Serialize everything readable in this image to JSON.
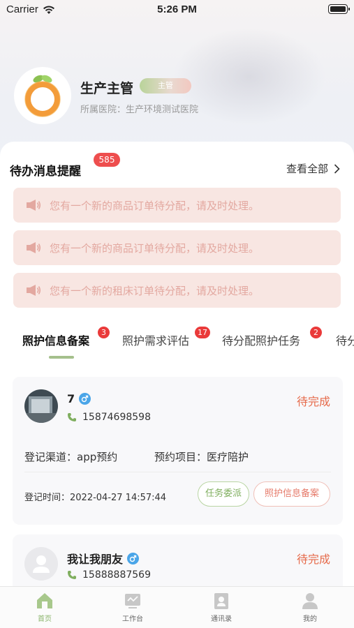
{
  "status_bar": {
    "carrier": "Carrier",
    "time": "5:26 PM"
  },
  "profile": {
    "name": "生产主管",
    "role": "主管",
    "hospital": "所属医院：生产环境测试医院"
  },
  "todo": {
    "title": "待办消息提醒",
    "count": "585",
    "view_all": "查看全部",
    "messages": [
      "您有一个新的商品订单待分配，请及时处理。",
      "您有一个新的商品订单待分配，请及时处理。",
      "您有一个新的租床订单待分配，请及时处理。"
    ]
  },
  "tabs": [
    {
      "label": "照护信息备案",
      "badge": "3"
    },
    {
      "label": "照护需求评估",
      "badge": "17"
    },
    {
      "label": "待分配照护任务",
      "badge": "2"
    },
    {
      "label": "待分",
      "badge": ""
    }
  ],
  "cards": [
    {
      "name": "7",
      "phone": "15874698598",
      "status": "待完成",
      "channel": "登记渠道：app预约",
      "project": "预约项目：医疗陪护",
      "time": "登记时间：2022-04-27 14:57:44",
      "btn_assign": "任务委派",
      "btn_record": "照护信息备案"
    },
    {
      "name": "我让我朋友",
      "phone": "15888887569",
      "status": "待完成"
    }
  ],
  "nav": [
    {
      "label": "首页",
      "icon": "home-icon"
    },
    {
      "label": "工作台",
      "icon": "workbench-icon"
    },
    {
      "label": "通讯录",
      "icon": "contacts-icon"
    },
    {
      "label": "我的",
      "icon": "profile-icon"
    }
  ],
  "colors": {
    "accent_green": "#8ab46a",
    "badge_red": "#ea3a3a",
    "status_orange": "#e66a4a",
    "message_bg": "#f8e6e2"
  }
}
